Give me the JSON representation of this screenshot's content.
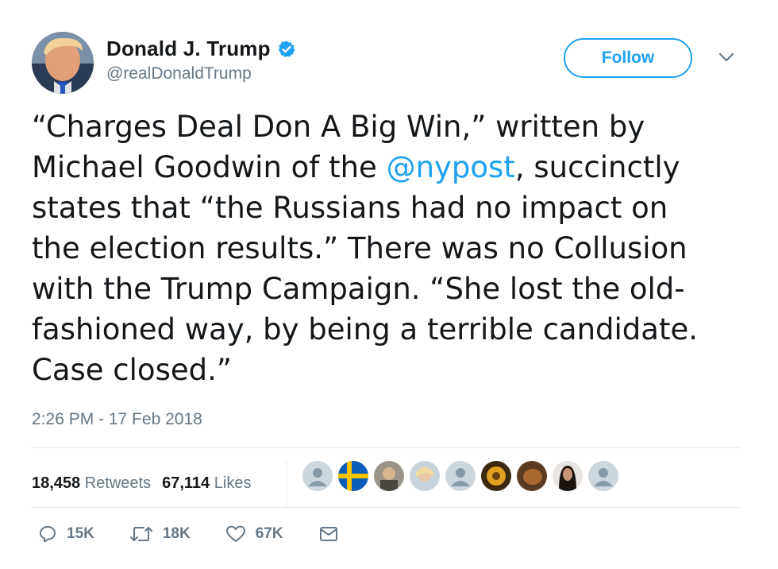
{
  "tweet": {
    "author": {
      "display_name": "Donald J. Trump",
      "handle": "@realDonaldTrump",
      "verified": true
    },
    "follow_label": "Follow",
    "text": {
      "part1": "“Charges Deal Don A Big Win,” written by\nMichael Goodwin of the ",
      "mention": "@nypost",
      "part2": ", succinctly\nstates that “the Russians had no impact on\nthe election results.” There was no Collusion\nwith the Trump Campaign. “She lost the old-\nfashioned way, by being a terrible candidate.\nCase closed.”"
    },
    "timestamp": "2:26 PM - 17 Feb 2018",
    "stats": {
      "retweets_count": "18,458",
      "retweets_label": "Retweets",
      "likes_count": "67,114",
      "likes_label": "Likes"
    },
    "actions": {
      "reply_count": "15K",
      "retweet_count": "18K",
      "like_count": "67K"
    },
    "likers": [
      "default-avatar",
      "sweden-flag-avatar",
      "photo-avatar",
      "photo-avatar",
      "default-avatar",
      "photo-avatar",
      "photo-avatar",
      "photo-avatar",
      "default-avatar"
    ]
  },
  "colors": {
    "accent": "#1da1f2",
    "secondary_text": "#657786",
    "text": "#14171a",
    "divider": "#e6ecf0"
  },
  "icons": [
    "verified-badge-icon",
    "chevron-down-icon",
    "reply-icon",
    "retweet-icon",
    "like-heart-icon",
    "direct-message-icon"
  ]
}
